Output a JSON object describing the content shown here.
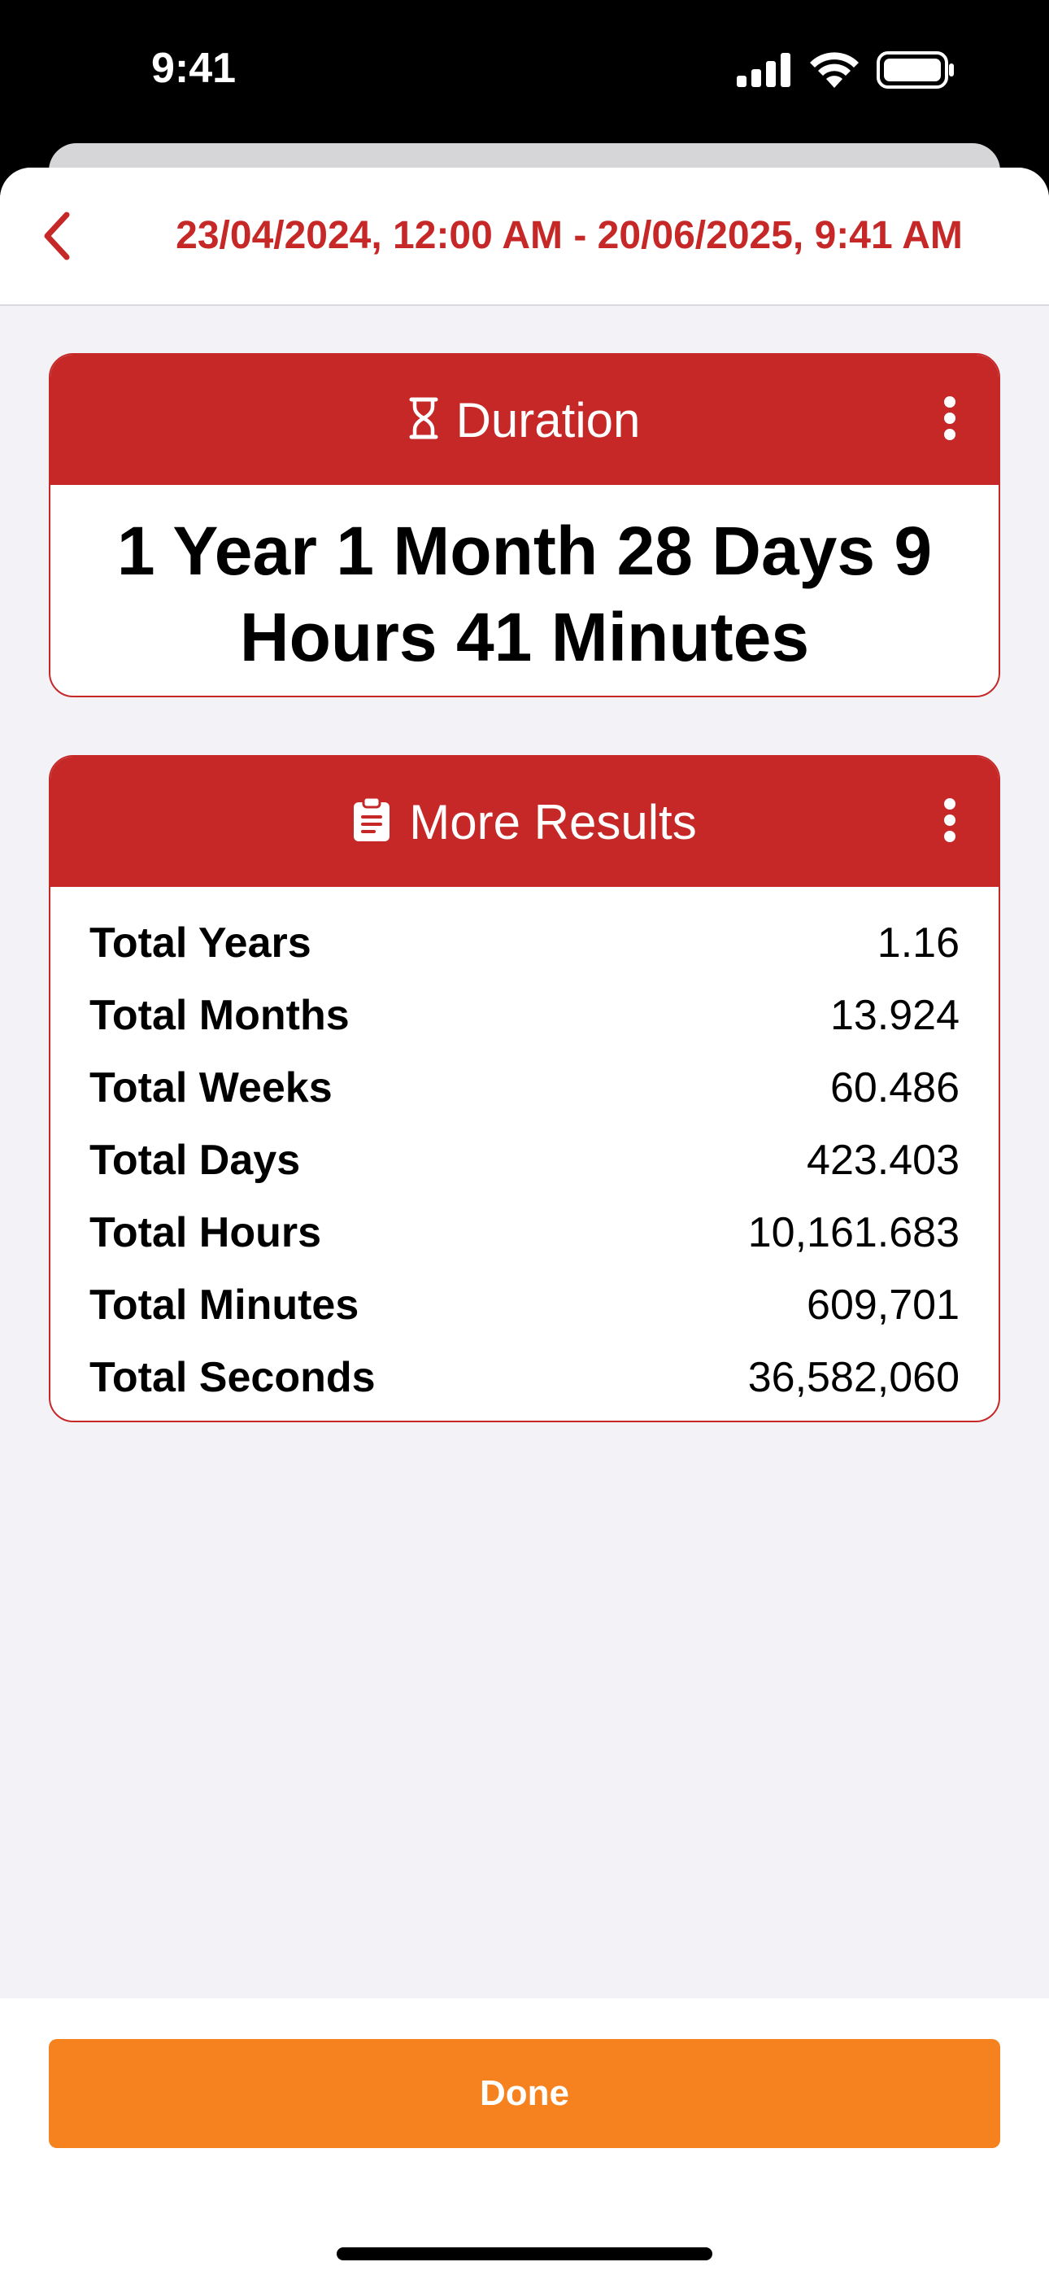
{
  "status_bar": {
    "time": "9:41"
  },
  "nav": {
    "title": "23/04/2024, 12:00 AM - 20/06/2025, 9:41 AM",
    "back_icon": "chevron-left-icon"
  },
  "duration_card": {
    "title": "Duration",
    "icon": "hourglass-icon",
    "value": "1 Year 1 Month 28 Days 9 Hours 41 Minutes"
  },
  "results_card": {
    "title": "More Results",
    "icon": "clipboard-icon",
    "rows": [
      {
        "label": "Total Years",
        "value": "1.16"
      },
      {
        "label": "Total Months",
        "value": "13.924"
      },
      {
        "label": "Total Weeks",
        "value": "60.486"
      },
      {
        "label": "Total Days",
        "value": "423.403"
      },
      {
        "label": "Total Hours",
        "value": "10,161.683"
      },
      {
        "label": "Total Minutes",
        "value": "609,701"
      },
      {
        "label": "Total Seconds",
        "value": "36,582,060"
      }
    ]
  },
  "footer": {
    "done_label": "Done"
  },
  "colors": {
    "accent_red": "#c62828",
    "done_orange": "#f5821f",
    "background": "#f2f2f7"
  }
}
